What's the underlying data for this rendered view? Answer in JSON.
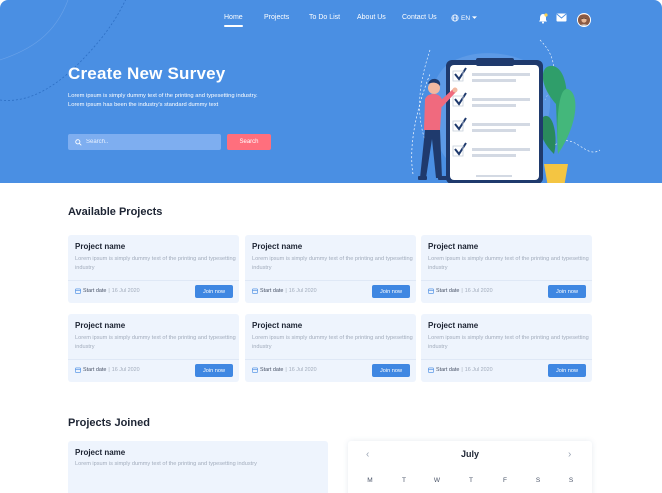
{
  "colors": {
    "hero_bg": "#4a8fe3",
    "accent": "#3f87e2",
    "search_button": "#ff6f7d",
    "card_bg": "#eef4fd"
  },
  "nav": {
    "items": [
      {
        "label": "Home",
        "active": true
      },
      {
        "label": "Projects",
        "active": false
      },
      {
        "label": "To Do List",
        "active": false
      },
      {
        "label": "About Us",
        "active": false
      },
      {
        "label": "Contact Us",
        "active": false
      }
    ],
    "language": "EN",
    "icons": [
      "globe-icon",
      "bell-icon",
      "mail-icon",
      "avatar"
    ]
  },
  "hero": {
    "title": "Create New Survey",
    "subtitle_line1": "Lorem ipsum is simply dummy text of the printing and typesetting industry.",
    "subtitle_line2": "Lorem ipsum has been the industry's standard dummy text",
    "search_placeholder": "Search..",
    "search_button": "Search"
  },
  "available": {
    "title": "Available Projects",
    "date_label": "Start date",
    "join_label": "Join now",
    "projects": [
      {
        "name": "Project name",
        "desc": "Lorem ipsum is simply dummy text of the printing and typesetting industry",
        "date": "16 Jul 2020"
      },
      {
        "name": "Project name",
        "desc": "Lorem ipsum is simply dummy text of the printing and typesetting industry",
        "date": "16 Jul 2020"
      },
      {
        "name": "Project name",
        "desc": "Lorem ipsum is simply dummy text of the printing and typesetting industry",
        "date": "16 Jul 2020"
      },
      {
        "name": "Project name",
        "desc": "Lorem ipsum is simply dummy text of the printing and typesetting industry",
        "date": "16 Jul 2020"
      },
      {
        "name": "Project name",
        "desc": "Lorem ipsum is simply dummy text of the printing and typesetting industry",
        "date": "16 Jul 2020"
      },
      {
        "name": "Project name",
        "desc": "Lorem ipsum is simply dummy text of the printing and typesetting industry",
        "date": "16 Jul 2020"
      }
    ]
  },
  "joined": {
    "title": "Projects Joined",
    "project": {
      "name": "Project name",
      "desc": "Lorem ipsum is simply dummy text of the printing and typesetting industry"
    }
  },
  "calendar": {
    "month": "July",
    "weekdays": [
      "M",
      "T",
      "W",
      "T",
      "F",
      "S",
      "S"
    ]
  }
}
